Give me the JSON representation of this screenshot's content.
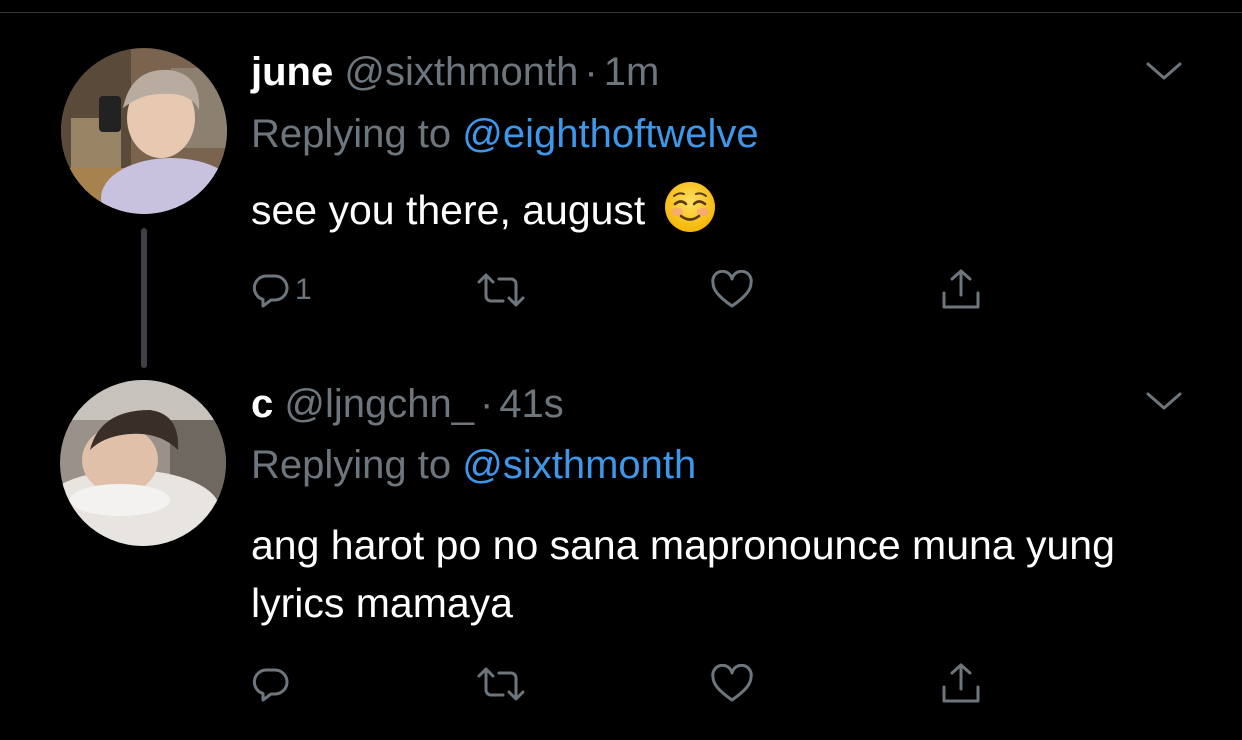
{
  "tweets": [
    {
      "display_name": "june",
      "handle": "@sixthmonth",
      "separator": "·",
      "time": "1m",
      "replying_prefix": "Replying to",
      "replying_to": "@eighthoftwelve",
      "text": "see you there, august",
      "emoji": "smiling-face-icon",
      "reply_count": "1"
    },
    {
      "display_name": "c",
      "handle": "@ljngchn_",
      "separator": "·",
      "time": "41s",
      "replying_prefix": "Replying to",
      "replying_to": "@sixthmonth",
      "text": "ang harot po no sana mapronounce muna yung lyrics mamaya",
      "reply_count": ""
    }
  ],
  "colors": {
    "background": "#000000",
    "primary_text": "#ffffff",
    "secondary_text": "#6e767d",
    "mention": "#3e97e8",
    "thread_line": "#3d4145"
  },
  "icons": [
    "reply-icon",
    "retweet-icon",
    "like-icon",
    "share-icon",
    "chevron-down-icon"
  ]
}
